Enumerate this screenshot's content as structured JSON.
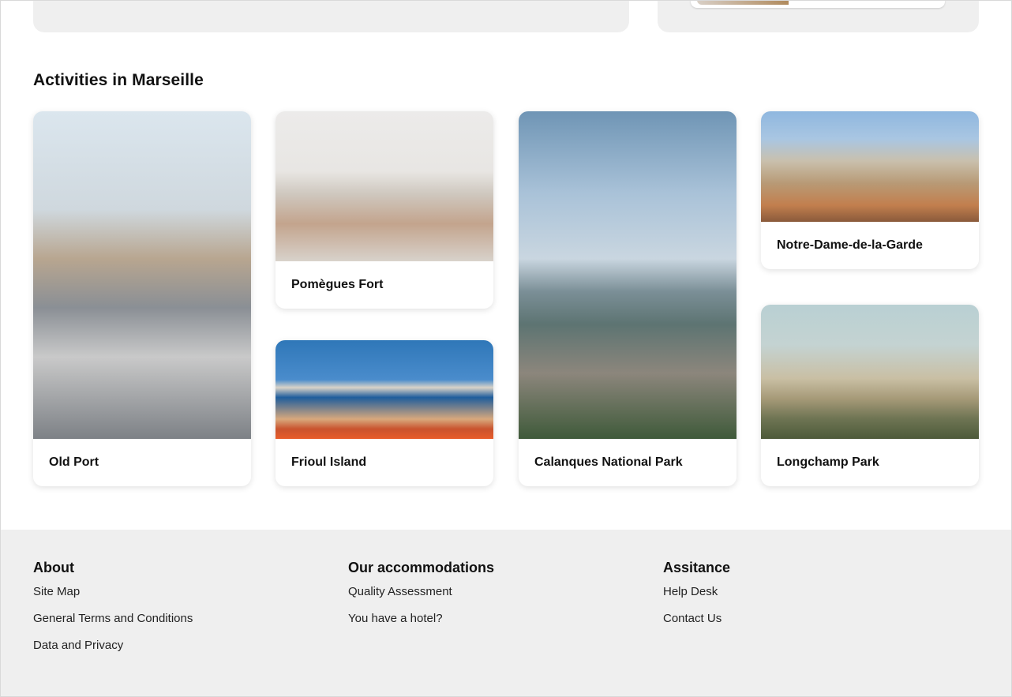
{
  "section": {
    "title": "Activities in Marseille"
  },
  "activities": [
    {
      "name": "Old Port"
    },
    {
      "name": "Pomègues Fort"
    },
    {
      "name": "Frioul Island"
    },
    {
      "name": "Calanques National Park"
    },
    {
      "name": "Notre-Dame-de-la-Garde"
    },
    {
      "name": "Longchamp Park"
    }
  ],
  "footer": {
    "about": {
      "title": "About",
      "links": [
        "Site Map",
        "General Terms and Conditions",
        "Data and Privacy"
      ]
    },
    "accommodations": {
      "title": "Our accommodations",
      "links": [
        "Quality Assessment",
        "You have a hotel?"
      ]
    },
    "assistance": {
      "title": "Assitance",
      "links": [
        "Help Desk",
        "Contact Us"
      ]
    }
  }
}
